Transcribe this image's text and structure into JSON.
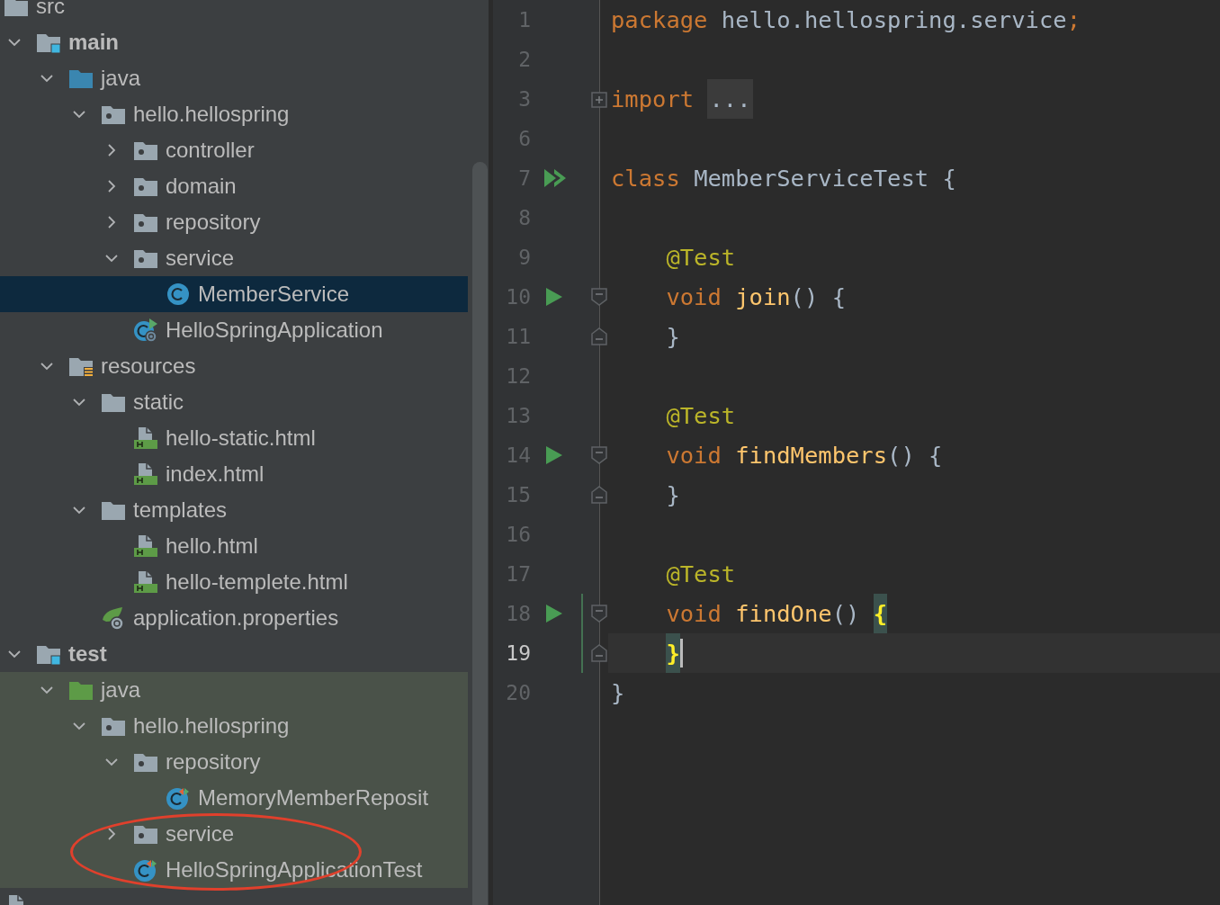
{
  "project_tree": [
    {
      "label": "src",
      "kind": "folder",
      "selected": false,
      "children": [
        {
          "label": "main",
          "kind": "module",
          "selected": false,
          "expanded": true,
          "children": [
            {
              "label": "java",
              "kind": "source-folder",
              "selected": false,
              "expanded": true,
              "children": [
                {
                  "label": "hello.hellospring",
                  "kind": "package",
                  "selected": false,
                  "expanded": true,
                  "children": [
                    {
                      "label": "controller",
                      "kind": "package",
                      "selected": false,
                      "expanded": false
                    },
                    {
                      "label": "domain",
                      "kind": "package",
                      "selected": false,
                      "expanded": false
                    },
                    {
                      "label": "repository",
                      "kind": "package",
                      "selected": false,
                      "expanded": false
                    },
                    {
                      "label": "service",
                      "kind": "package",
                      "selected": false,
                      "expanded": true,
                      "children": [
                        {
                          "label": "MemberService",
                          "kind": "class",
                          "selected": true
                        }
                      ]
                    },
                    {
                      "label": "HelloSpringApplication",
                      "kind": "spring-app",
                      "selected": false
                    }
                  ]
                }
              ]
            },
            {
              "label": "resources",
              "kind": "resources",
              "selected": false,
              "expanded": true,
              "children": [
                {
                  "label": "static",
                  "kind": "folder",
                  "selected": false,
                  "expanded": true,
                  "children": [
                    {
                      "label": "hello-static.html",
                      "kind": "html",
                      "selected": false
                    },
                    {
                      "label": "index.html",
                      "kind": "html",
                      "selected": false
                    }
                  ]
                },
                {
                  "label": "templates",
                  "kind": "folder",
                  "selected": false,
                  "expanded": true,
                  "children": [
                    {
                      "label": "hello.html",
                      "kind": "html",
                      "selected": false
                    },
                    {
                      "label": "hello-templete.html",
                      "kind": "html",
                      "selected": false
                    }
                  ]
                },
                {
                  "label": "application.properties",
                  "kind": "properties",
                  "selected": false
                }
              ]
            }
          ]
        },
        {
          "label": "test",
          "kind": "module",
          "selected": false,
          "expanded": true,
          "children": [
            {
              "label": "java",
              "kind": "test-folder",
              "selected": false,
              "expanded": true,
              "highlight": true,
              "children": [
                {
                  "label": "hello.hellospring",
                  "kind": "package",
                  "selected": false,
                  "expanded": true,
                  "children": [
                    {
                      "label": "repository",
                      "kind": "package",
                      "selected": false,
                      "expanded": true,
                      "children": [
                        {
                          "label": "MemoryMemberReposit",
                          "kind": "test-class",
                          "selected": false
                        }
                      ]
                    },
                    {
                      "label": "service",
                      "kind": "package",
                      "selected": false,
                      "expanded": false
                    },
                    {
                      "label": "HelloSpringApplicationTest",
                      "kind": "test-class",
                      "selected": false
                    }
                  ]
                }
              ]
            }
          ]
        }
      ]
    },
    {
      "kind": "file",
      "selected": false
    }
  ],
  "annotations": [
    {
      "kind": "ellipse"
    }
  ],
  "editor": {
    "lines": [
      {
        "number": "1",
        "current": false,
        "changed": false,
        "tokens": [
          {
            "kind": "keyword",
            "text": "package "
          },
          {
            "kind": "plain",
            "text": "hello.hellospring.service"
          },
          {
            "kind": "keyword",
            "text": ";"
          }
        ]
      },
      {
        "number": "2",
        "current": false,
        "changed": false
      },
      {
        "number": "3",
        "current": false,
        "changed": false,
        "fold": {
          "kind": "collapsed"
        },
        "tokens": [
          {
            "kind": "keyword",
            "text": "import "
          },
          {
            "kind": "folded",
            "text": "..."
          }
        ]
      },
      {
        "number": "6",
        "current": false,
        "changed": false
      },
      {
        "number": "7",
        "current": false,
        "changed": false,
        "run": {
          "kind": "double"
        },
        "tokens": [
          {
            "kind": "keyword",
            "text": "class "
          },
          {
            "kind": "plain",
            "text": "MemberServiceTest {"
          }
        ]
      },
      {
        "number": "8",
        "current": false,
        "changed": false
      },
      {
        "number": "9",
        "current": false,
        "changed": false,
        "tokens": [
          {
            "kind": "annotation",
            "text": "    @Test"
          }
        ]
      },
      {
        "number": "10",
        "current": false,
        "changed": false,
        "run": {
          "kind": "single"
        },
        "fold": {
          "kind": "start"
        },
        "tokens": [
          {
            "kind": "keyword",
            "text": "    void "
          },
          {
            "kind": "method",
            "text": "join"
          },
          {
            "kind": "plain",
            "text": "() {"
          }
        ]
      },
      {
        "number": "11",
        "current": false,
        "changed": false,
        "fold": {
          "kind": "end"
        },
        "tokens": [
          {
            "kind": "plain",
            "text": "    }"
          }
        ]
      },
      {
        "number": "12",
        "current": false,
        "changed": false
      },
      {
        "number": "13",
        "current": false,
        "changed": false,
        "tokens": [
          {
            "kind": "annotation",
            "text": "    @Test"
          }
        ]
      },
      {
        "number": "14",
        "current": false,
        "changed": false,
        "run": {
          "kind": "single"
        },
        "fold": {
          "kind": "start"
        },
        "tokens": [
          {
            "kind": "keyword",
            "text": "    void "
          },
          {
            "kind": "method",
            "text": "findMembers"
          },
          {
            "kind": "plain",
            "text": "() {"
          }
        ]
      },
      {
        "number": "15",
        "current": false,
        "changed": false,
        "fold": {
          "kind": "end"
        },
        "tokens": [
          {
            "kind": "plain",
            "text": "    }"
          }
        ]
      },
      {
        "number": "16",
        "current": false,
        "changed": false
      },
      {
        "number": "17",
        "current": false,
        "changed": false,
        "tokens": [
          {
            "kind": "annotation",
            "text": "    @Test"
          }
        ]
      },
      {
        "number": "18",
        "current": false,
        "changed": true,
        "run": {
          "kind": "single"
        },
        "fold": {
          "kind": "start"
        },
        "tokens": [
          {
            "kind": "keyword",
            "text": "    void "
          },
          {
            "kind": "method",
            "text": "findOne"
          },
          {
            "kind": "plain",
            "text": "() "
          },
          {
            "kind": "brace-match",
            "text": "{"
          }
        ]
      },
      {
        "number": "19",
        "current": true,
        "changed": true,
        "fold": {
          "kind": "end"
        },
        "tokens": [
          {
            "kind": "brace-match",
            "text": "    }"
          }
        ]
      },
      {
        "number": "20",
        "current": false,
        "changed": false,
        "tokens": [
          {
            "kind": "plain",
            "text": "}"
          }
        ]
      }
    ]
  }
}
